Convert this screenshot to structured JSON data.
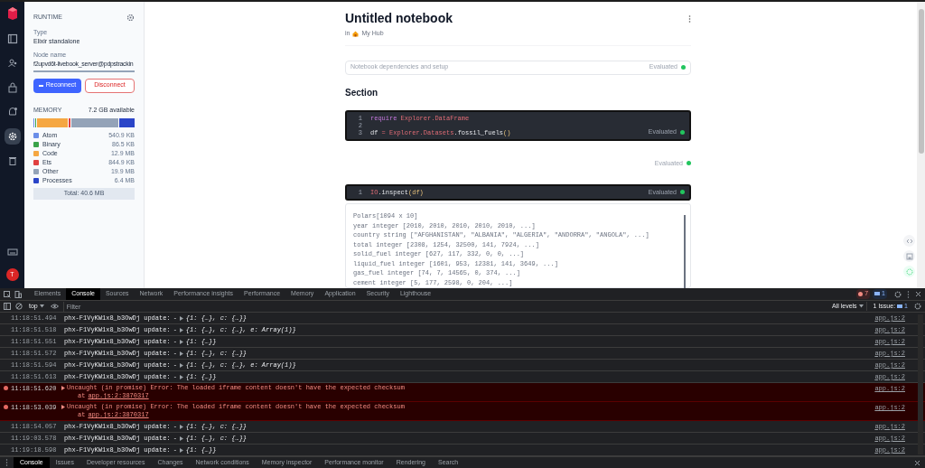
{
  "rail": {
    "items": [
      {
        "selected": false
      },
      {
        "selected": false
      },
      {
        "selected": false
      },
      {
        "selected": false
      },
      {
        "selected": true
      },
      {
        "selected": false
      }
    ],
    "avatar": "T"
  },
  "runtime": {
    "heading": "RUNTIME",
    "type_label": "Type",
    "type_value": "Elixir standalone",
    "node_label": "Node name",
    "node_value": "f2upvd6t-livebook_server@pdpstrackin",
    "reconnect": "Reconnect",
    "disconnect": "Disconnect"
  },
  "memory": {
    "heading": "MEMORY",
    "available": "7.2 GB available",
    "items": [
      {
        "name": "Atom",
        "value": "540.9 KB",
        "color": "#6b8ee8"
      },
      {
        "name": "Binary",
        "value": "86.5 KB",
        "color": "#3aa34a"
      },
      {
        "name": "Code",
        "value": "12.9 MB",
        "color": "#f5a742"
      },
      {
        "name": "Ets",
        "value": "844.9 KB",
        "color": "#e04040"
      },
      {
        "name": "Other",
        "value": "19.9 MB",
        "color": "#94a3b8"
      },
      {
        "name": "Processes",
        "value": "6.4 MB",
        "color": "#2b45c8"
      }
    ],
    "total": "Total: 40.6 MB"
  },
  "notebook": {
    "title": "Untitled notebook",
    "in": "in",
    "hub": "My Hub",
    "setup": {
      "label": "Notebook dependencies and setup",
      "status": "Evaluated"
    },
    "section": "Section",
    "cells": [
      {
        "kind": "code",
        "lines": [
          {
            "number": "1",
            "tokens": [
              {
                "kind": "keyword",
                "text": "require"
              },
              {
                "kind": "module",
                "text": "Explorer.DataFrame"
              }
            ]
          },
          {
            "number": "2"
          },
          {
            "number": "3",
            "tokens": [
              {
                "kind": "plain",
                "text": "df"
              },
              {
                "kind": "operator",
                "text": "="
              },
              {
                "kind": "module",
                "text": "Explorer.Datasets"
              },
              {
                "kind": "plain",
                "text": ".fossil_fuels"
              },
              {
                "kind": "paren",
                "text": "()"
              }
            ]
          }
        ],
        "status": "Evaluated"
      },
      {
        "kind": "status",
        "status": "Evaluated"
      },
      {
        "kind": "code",
        "lines": [
          {
            "number": "1",
            "tokens": [
              {
                "kind": "module",
                "text": "IO"
              },
              {
                "kind": "plain",
                "text": ".inspect"
              },
              {
                "kind": "paren",
                "text": "(df)"
              }
            ]
          }
        ],
        "status": "Evaluated",
        "output": [
          "Polars[1094 x 10]",
          "year integer [2010, 2010, 2010, 2010, 2010, ...]",
          "country string [\"AFGHANISTAN\", \"ALBANIA\", \"ALGERIA\", \"ANDORRA\", \"ANGOLA\", ...]",
          "total integer [2308, 1254, 32500, 141, 7924, ...]",
          "solid_fuel integer [627, 117, 332, 0, 0, ...]",
          "liquid_fuel integer [1601, 953, 12381, 141, 3649, ...]",
          "gas_fuel integer [74, 7, 14565, 0, 374, ...]",
          "cement integer [5, 177, 2598, 0, 204, ...]"
        ]
      }
    ]
  },
  "devtools": {
    "tabs": [
      {
        "label": "Elements",
        "selected": false
      },
      {
        "label": "Console",
        "selected": true
      },
      {
        "label": "Sources",
        "selected": false
      },
      {
        "label": "Network",
        "selected": false
      },
      {
        "label": "Performance insights",
        "selected": false
      },
      {
        "label": "Performance",
        "selected": false
      },
      {
        "label": "Memory",
        "selected": false
      },
      {
        "label": "Application",
        "selected": false
      },
      {
        "label": "Security",
        "selected": false
      },
      {
        "label": "Lighthouse",
        "selected": false
      }
    ],
    "error_count": "7",
    "info_count": "1",
    "context": "top",
    "filter_placeholder": "Filter",
    "levels": "All levels",
    "issues_label": "1 Issue:",
    "issues_count": "1",
    "rows": [
      {
        "kind": "log",
        "time": "11:18:51.494",
        "source": "phx-F1VyKW1x8_b3OwDj update:",
        "dash": "-",
        "object": "{1: {…}, c: {…}}",
        "link": "app.js:2"
      },
      {
        "kind": "log",
        "time": "11:18:51.518",
        "source": "phx-F1VyKW1x8_b3OwDj update:",
        "dash": "-",
        "object": "{1: {…}, c: {…}, e: Array(1)}",
        "link": "app.js:2"
      },
      {
        "kind": "log",
        "time": "11:18:51.551",
        "source": "phx-F1VyKW1x8_b3OwDj update:",
        "dash": "-",
        "object": "{1: {…}}",
        "link": "app.js:2"
      },
      {
        "kind": "log",
        "time": "11:18:51.572",
        "source": "phx-F1VyKW1x8_b3OwDj update:",
        "dash": "-",
        "object": "{1: {…}, c: {…}}",
        "link": "app.js:2"
      },
      {
        "kind": "log",
        "time": "11:18:51.594",
        "source": "phx-F1VyKW1x8_b3OwDj update:",
        "dash": "-",
        "object": "{1: {…}, c: {…}, e: Array(1)}",
        "link": "app.js:2"
      },
      {
        "kind": "log",
        "time": "11:18:51.613",
        "source": "phx-F1VyKW1x8_b3OwDj update:",
        "dash": "-",
        "object": "{1: {…}}",
        "link": "app.js:2"
      },
      {
        "kind": "error",
        "time": "11:18:51.620",
        "message": "Uncaught (in promise) Error: The loaded iframe content doesn't have the expected checksum",
        "at": "at",
        "stack_link": "app.js:2:3870317",
        "link": "app.js:2"
      },
      {
        "kind": "error",
        "time": "11:18:53.039",
        "message": "Uncaught (in promise) Error: The loaded iframe content doesn't have the expected checksum",
        "at": "at",
        "stack_link": "app.js:2:3870317",
        "link": "app.js:2"
      },
      {
        "kind": "log",
        "time": "11:18:54.057",
        "source": "phx-F1VyKW1x8_b3OwDj update:",
        "dash": "-",
        "object": "{1: {…}, c: {…}}",
        "link": "app.js:2"
      },
      {
        "kind": "log",
        "time": "11:19:03.578",
        "source": "phx-F1VyKW1x8_b3OwDj update:",
        "dash": "-",
        "object": "{1: {…}, c: {…}}",
        "link": "app.js:2"
      },
      {
        "kind": "log",
        "time": "11:19:18.598",
        "source": "phx-F1VyKW1x8_b3OwDj update:",
        "dash": "-",
        "object": "{1: {…}}",
        "link": "app.js:2"
      }
    ],
    "drawer_tabs": [
      {
        "label": "Console",
        "selected": true
      },
      {
        "label": "Issues",
        "selected": false
      },
      {
        "label": "Developer resources",
        "selected": false
      },
      {
        "label": "Changes",
        "selected": false
      },
      {
        "label": "Network conditions",
        "selected": false
      },
      {
        "label": "Memory inspector",
        "selected": false
      },
      {
        "label": "Performance monitor",
        "selected": false
      },
      {
        "label": "Rendering",
        "selected": false
      },
      {
        "label": "Search",
        "selected": false
      }
    ]
  }
}
